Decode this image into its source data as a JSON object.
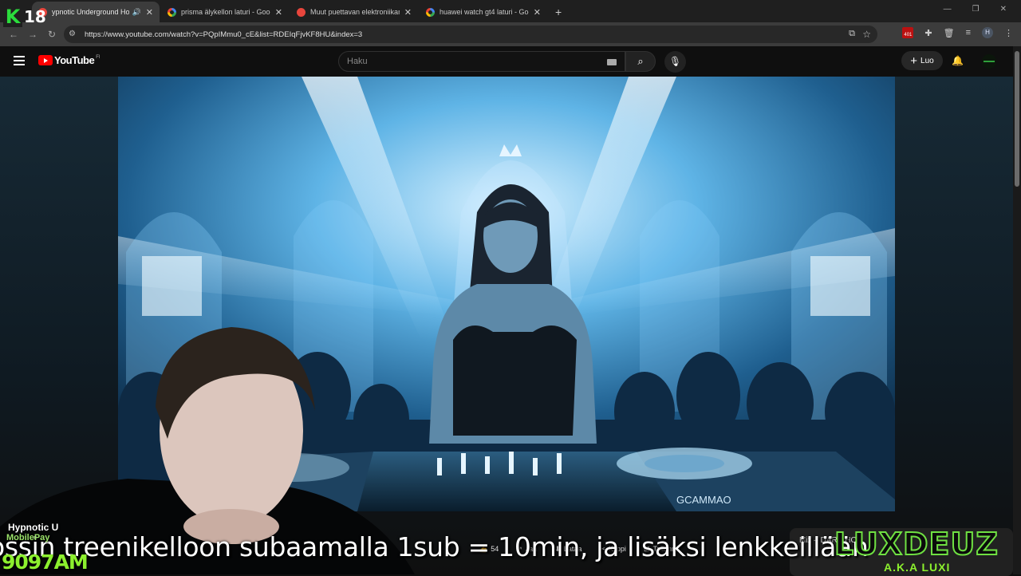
{
  "browser": {
    "tabs": [
      {
        "label": "ypnotic Underground Ho",
        "favicon": "youtube-icon",
        "active": true,
        "audio": true
      },
      {
        "label": "prisma älykellon laturi - Google",
        "favicon": "google-icon",
        "active": false
      },
      {
        "label": "Muut puettavan elektroniikan",
        "favicon": "site-icon",
        "active": false
      },
      {
        "label": "huawei watch gt4 laturi - Goog",
        "favicon": "google-icon",
        "active": false
      }
    ],
    "url": "https://www.youtube.com/watch?v=PQpIMmu0_cE&list=RDEIqFjvKF8HU&index=3",
    "ext_badge": "401",
    "profile_initial": "H"
  },
  "overlay_logo": {
    "letter": "K",
    "number": "18"
  },
  "youtube": {
    "logo_text": "YouTube",
    "country": "FI",
    "search_placeholder": "Haku",
    "create_label": "Luo"
  },
  "video": {
    "mixer_brand": "GCAMMAO"
  },
  "video_actions": {
    "like_count": "54",
    "share": "Jaa",
    "download": "Lataa",
    "clip": "Klippi",
    "save": "Tallenna"
  },
  "playlist": {
    "title": "Mix – DARK HOU"
  },
  "stream_overlay": {
    "name": "Hypnotic U",
    "mobilepay": "MobilePay",
    "code": "9097AM",
    "ticker": "ossin treenikelloon subaamalla 1sub = 10min, ja lisäksi lenkkeillään",
    "brand": "LUXDEUZ",
    "brand_sub": "A.K.A LUXI"
  }
}
